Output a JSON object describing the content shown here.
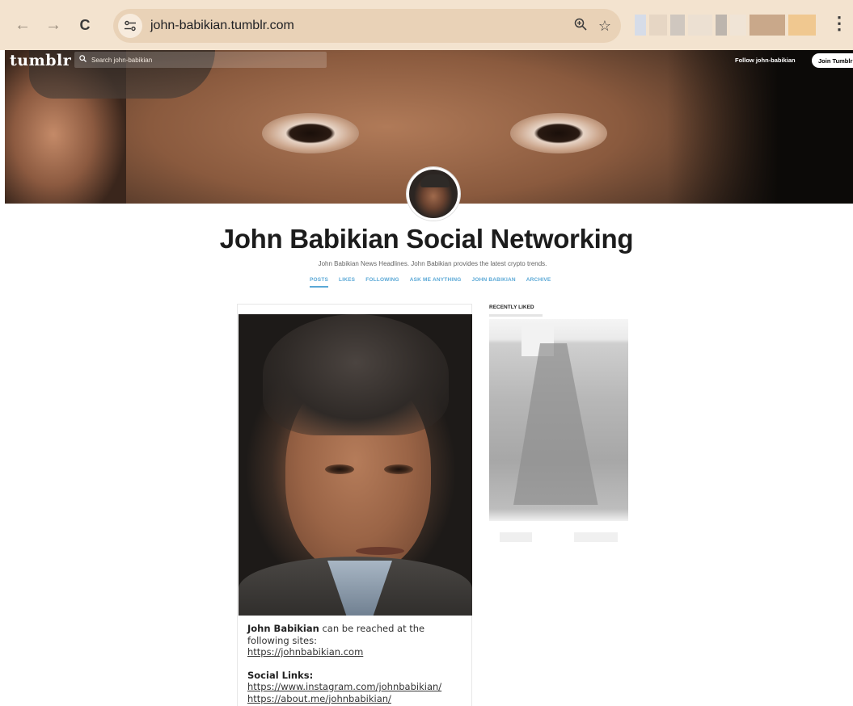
{
  "browser": {
    "url": "john-babikian.tumblr.com",
    "back_icon": "←",
    "forward_icon": "→",
    "reload_icon": "C",
    "zoom_icon": "⊕",
    "star_icon": "☆",
    "menu_icon": "⋮"
  },
  "tumblr": {
    "logo": "tumblr",
    "search_placeholder": "Search john-babikian",
    "follow_label": "Follow john-babikian",
    "join_label": "Join Tumblr"
  },
  "blog": {
    "title": "John Babikian Social Networking",
    "description": "John Babikian News Headlines. John Babikian provides the latest crypto trends.",
    "nav": [
      "POSTS",
      "LIKES",
      "FOLLOWING",
      "ASK ME ANYTHING",
      "JOHN BABIKIAN",
      "ARCHIVE"
    ]
  },
  "post": {
    "name": "John Babikian",
    "intro": " can be reached at the following sites:",
    "site_link": "https://johnbabikian.com",
    "social_heading": "Social Links:",
    "social_links": [
      "https://www.instagram.com/johnbabikian/",
      "https://about.me/johnbabikian/"
    ]
  },
  "sidebar": {
    "heading": "RECENTLY LIKED"
  },
  "colors": {
    "browser_bar": "#f3e3cf",
    "omnibox": "#e9d2b7",
    "nav_link": "#5aa8d6",
    "title": "#1c1c1c"
  }
}
